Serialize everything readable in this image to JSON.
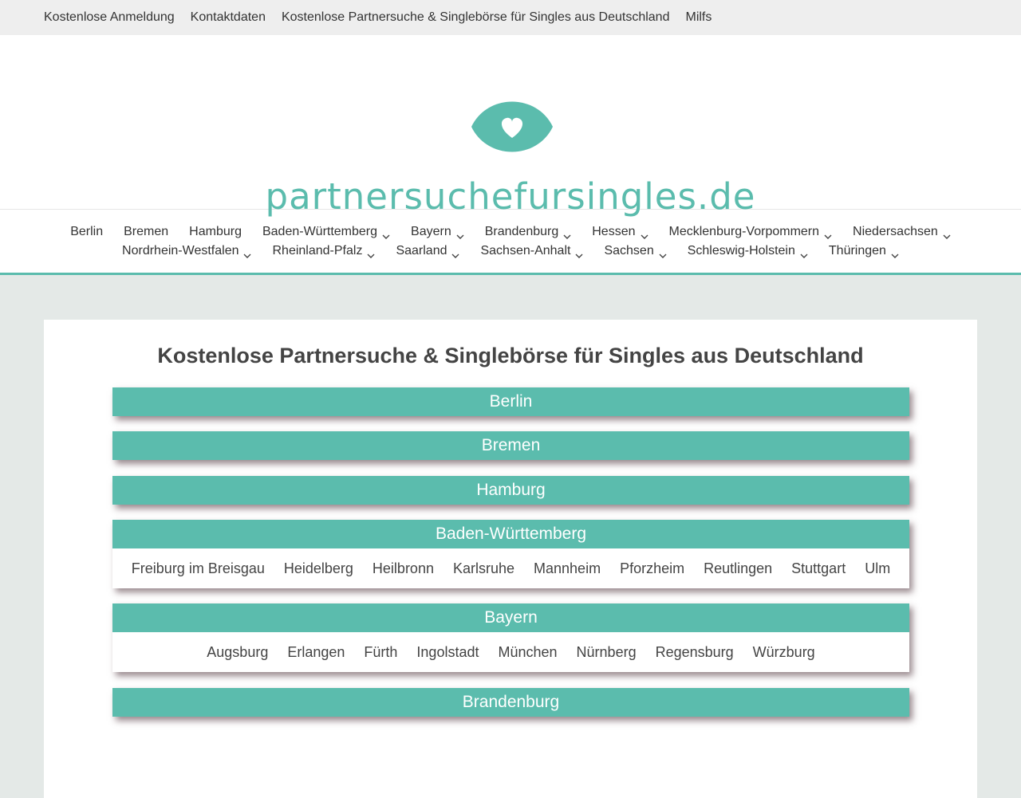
{
  "topbar": {
    "links": [
      "Kostenlose Anmeldung",
      "Kontaktdaten",
      "Kostenlose Partnersuche & Singlebörse für Singles aus Deutschland",
      "Milfs"
    ]
  },
  "header": {
    "logo_icon": "heart-eye-icon",
    "site_title": "partnersuchefursingles.de"
  },
  "nav": {
    "row1": [
      {
        "label": "Berlin",
        "dropdown": false
      },
      {
        "label": "Bremen",
        "dropdown": false
      },
      {
        "label": "Hamburg",
        "dropdown": false
      },
      {
        "label": "Baden-Württemberg",
        "dropdown": true
      },
      {
        "label": "Bayern",
        "dropdown": true
      },
      {
        "label": "Brandenburg",
        "dropdown": true
      },
      {
        "label": "Hessen",
        "dropdown": true
      },
      {
        "label": "Mecklenburg-Vorpommern",
        "dropdown": true
      },
      {
        "label": "Niedersachsen",
        "dropdown": true
      }
    ],
    "row2": [
      {
        "label": "Nordrhein-Westfalen",
        "dropdown": true
      },
      {
        "label": "Rheinland-Pfalz",
        "dropdown": true
      },
      {
        "label": "Saarland",
        "dropdown": true
      },
      {
        "label": "Sachsen-Anhalt",
        "dropdown": true
      },
      {
        "label": "Sachsen",
        "dropdown": true
      },
      {
        "label": "Schleswig-Holstein",
        "dropdown": true
      },
      {
        "label": "Thüringen",
        "dropdown": true
      }
    ]
  },
  "main": {
    "title": "Kostenlose Partnersuche & Singlebörse für Singles aus Deutschland",
    "regions": [
      {
        "name": "Berlin",
        "cities": []
      },
      {
        "name": "Bremen",
        "cities": []
      },
      {
        "name": "Hamburg",
        "cities": []
      },
      {
        "name": "Baden-Württemberg",
        "cities": [
          "Freiburg im Breisgau",
          "Heidelberg",
          "Heilbronn",
          "Karlsruhe",
          "Mannheim",
          "Pforzheim",
          "Reutlingen",
          "Stuttgart",
          "Ulm"
        ]
      },
      {
        "name": "Bayern",
        "cities": [
          "Augsburg",
          "Erlangen",
          "Fürth",
          "Ingolstadt",
          "München",
          "Nürnberg",
          "Regensburg",
          "Würzburg"
        ]
      },
      {
        "name": "Brandenburg",
        "cities": []
      }
    ]
  },
  "colors": {
    "accent": "#5bbcad",
    "page_bg": "#e4e9e7",
    "topbar_bg": "#eeeeee"
  }
}
